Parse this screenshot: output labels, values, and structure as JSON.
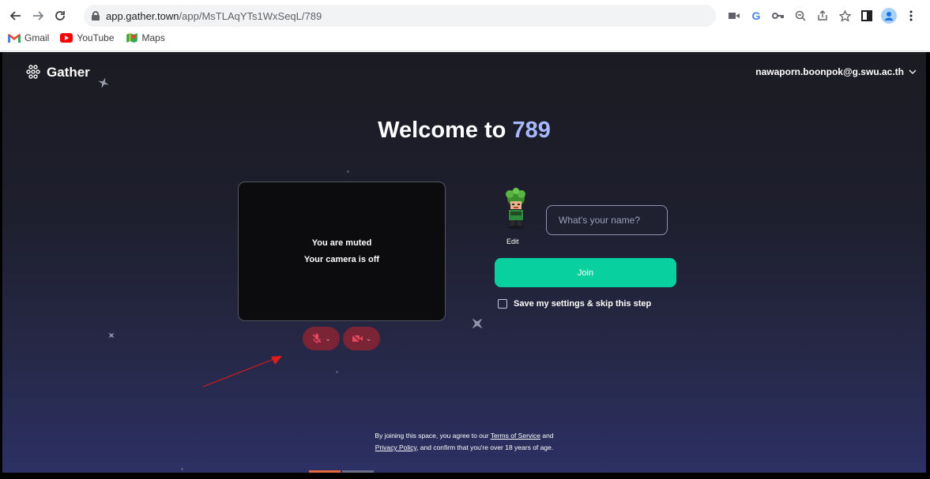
{
  "browser": {
    "url_host": "app.gather.town",
    "url_path": "/app/MsTLAqYTs1WxSeqL/789",
    "bookmarks": [
      {
        "label": "Gmail",
        "icon": "gmail-icon"
      },
      {
        "label": "YouTube",
        "icon": "youtube-icon"
      },
      {
        "label": "Maps",
        "icon": "maps-icon"
      }
    ]
  },
  "header": {
    "logo_text": "Gather",
    "user_email": "nawaporn.boonpok@g.swu.ac.th"
  },
  "welcome": {
    "prefix": "Welcome to ",
    "space_name": "789"
  },
  "preview": {
    "muted_text": "You are muted",
    "camera_text": "Your camera is off"
  },
  "profile": {
    "edit_label": "Edit",
    "name_placeholder": "What's your name?"
  },
  "actions": {
    "join_label": "Join",
    "skip_label": "Save my settings & skip this step"
  },
  "legal": {
    "line1_prefix": "By joining this space, you agree to our ",
    "terms_link": "Terms of Service",
    "line1_suffix": " and",
    "privacy_link": "Privacy Policy",
    "line2_suffix": ", and confirm that you're over 18 years of age."
  },
  "colors": {
    "accent_green": "#08d09f",
    "space_name_color": "#a8b8ff",
    "media_off_red": "#7a2436",
    "annotation_arrow": "#e01b1b"
  }
}
